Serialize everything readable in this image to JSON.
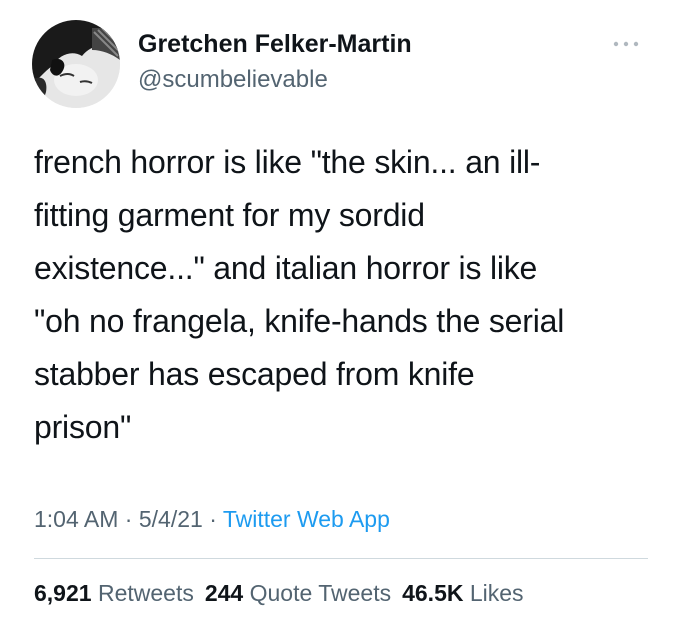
{
  "author": {
    "name": "Gretchen Felker-Martin",
    "handle": "@scumbelievable"
  },
  "more_icon": "more-horizontal-icon",
  "tweet": {
    "text": "french horror is like \"the skin... an ill-\nfitting garment for my sordid\nexistence...\" and italian horror is like\n\"oh no frangela, knife-hands the serial\nstabber has escaped from knife\nprison\""
  },
  "meta": {
    "time": "1:04 AM",
    "separator": "·",
    "date": "5/4/21",
    "source": "Twitter Web App"
  },
  "stats": {
    "retweets_count": "6,921",
    "retweets_label": "Retweets",
    "quotes_count": "244",
    "quotes_label": "Quote Tweets",
    "likes_count": "46.5K",
    "likes_label": "Likes"
  },
  "colors": {
    "text_primary": "#0f1419",
    "text_secondary": "#536471",
    "link": "#1d9bf0",
    "divider": "#cfd9de"
  }
}
